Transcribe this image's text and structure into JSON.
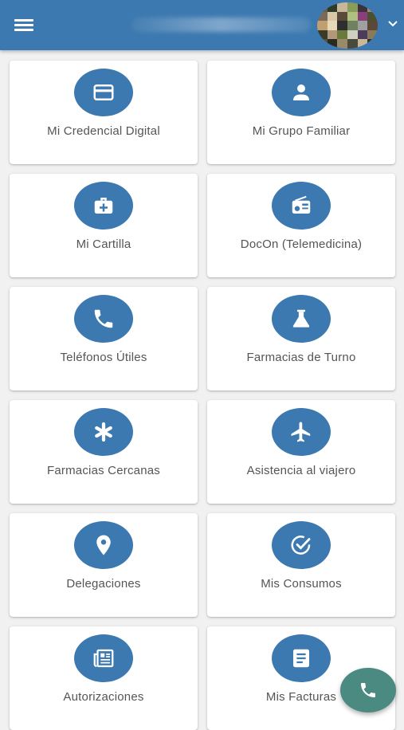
{
  "header": {
    "menu_icon": "hamburger-menu-icon",
    "avatar_icon": "user-avatar",
    "chevron_icon": "chevron-down-icon",
    "background_color": "#3c79b0"
  },
  "menu": {
    "items": [
      {
        "label": "Mi Credencial Digital",
        "icon": "credit-card-icon"
      },
      {
        "label": "Mi Grupo Familiar",
        "icon": "person-icon"
      },
      {
        "label": "Mi Cartilla",
        "icon": "medical-bag-icon"
      },
      {
        "label": "DocOn (Telemedicina)",
        "icon": "radio-icon"
      },
      {
        "label": "Teléfonos Útiles",
        "icon": "phone-icon"
      },
      {
        "label": "Farmacias de Turno",
        "icon": "flask-icon"
      },
      {
        "label": "Farmacias Cercanas",
        "icon": "asterisk-icon"
      },
      {
        "label": "Asistencia al viajero",
        "icon": "airplane-icon"
      },
      {
        "label": "Delegaciones",
        "icon": "location-pin-icon"
      },
      {
        "label": "Mis Consumos",
        "icon": "check-circle-icon"
      },
      {
        "label": "Autorizaciones",
        "icon": "newspaper-icon"
      },
      {
        "label": "Mis Facturas",
        "icon": "document-icon"
      }
    ]
  },
  "fab": {
    "icon": "phone-icon",
    "color": "#4a8a80"
  },
  "colors": {
    "accent": "#3c79b0",
    "card_text": "#555555"
  }
}
